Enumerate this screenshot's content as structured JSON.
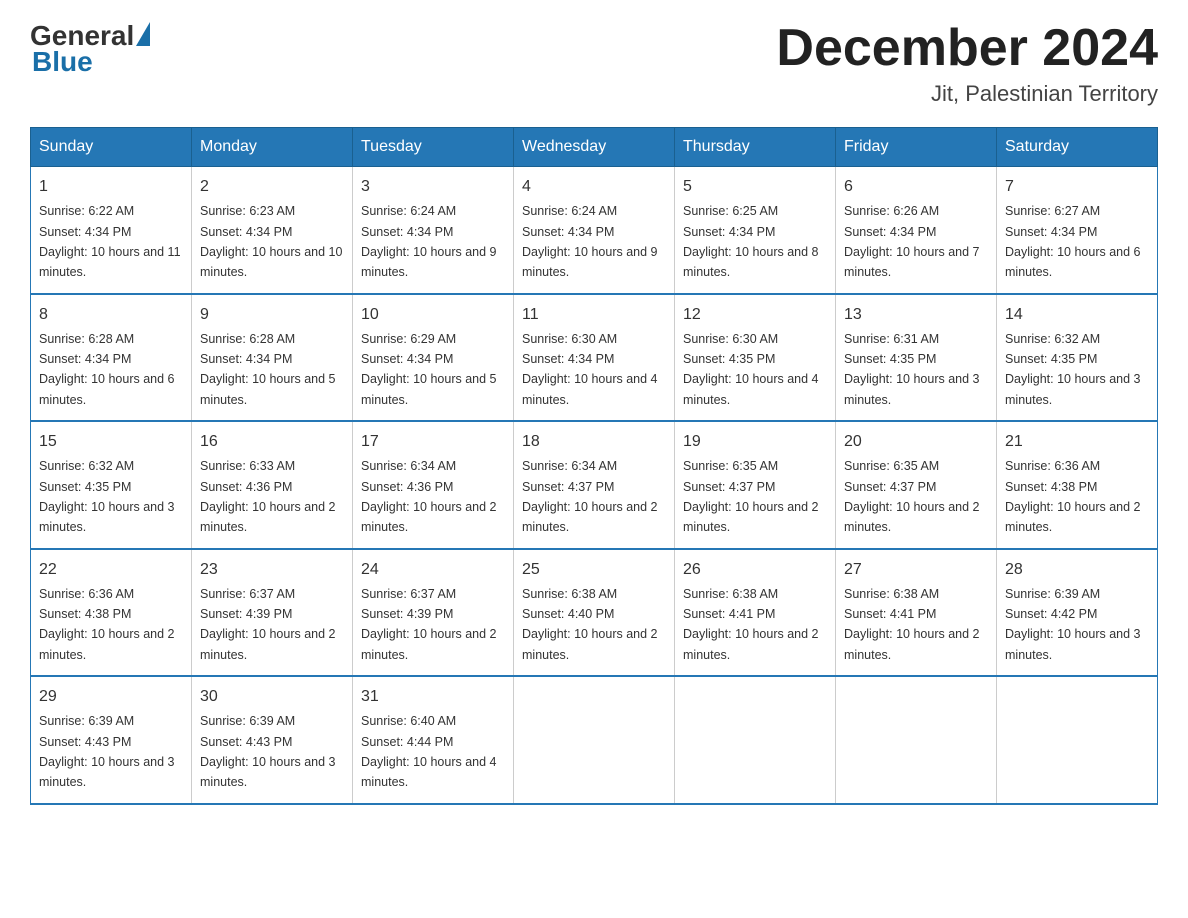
{
  "header": {
    "logo_general": "General",
    "logo_blue": "Blue",
    "month_year": "December 2024",
    "location": "Jit, Palestinian Territory"
  },
  "days_of_week": [
    "Sunday",
    "Monday",
    "Tuesday",
    "Wednesday",
    "Thursday",
    "Friday",
    "Saturday"
  ],
  "weeks": [
    [
      {
        "day": 1,
        "sunrise": "6:22 AM",
        "sunset": "4:34 PM",
        "daylight": "10 hours and 11 minutes."
      },
      {
        "day": 2,
        "sunrise": "6:23 AM",
        "sunset": "4:34 PM",
        "daylight": "10 hours and 10 minutes."
      },
      {
        "day": 3,
        "sunrise": "6:24 AM",
        "sunset": "4:34 PM",
        "daylight": "10 hours and 9 minutes."
      },
      {
        "day": 4,
        "sunrise": "6:24 AM",
        "sunset": "4:34 PM",
        "daylight": "10 hours and 9 minutes."
      },
      {
        "day": 5,
        "sunrise": "6:25 AM",
        "sunset": "4:34 PM",
        "daylight": "10 hours and 8 minutes."
      },
      {
        "day": 6,
        "sunrise": "6:26 AM",
        "sunset": "4:34 PM",
        "daylight": "10 hours and 7 minutes."
      },
      {
        "day": 7,
        "sunrise": "6:27 AM",
        "sunset": "4:34 PM",
        "daylight": "10 hours and 6 minutes."
      }
    ],
    [
      {
        "day": 8,
        "sunrise": "6:28 AM",
        "sunset": "4:34 PM",
        "daylight": "10 hours and 6 minutes."
      },
      {
        "day": 9,
        "sunrise": "6:28 AM",
        "sunset": "4:34 PM",
        "daylight": "10 hours and 5 minutes."
      },
      {
        "day": 10,
        "sunrise": "6:29 AM",
        "sunset": "4:34 PM",
        "daylight": "10 hours and 5 minutes."
      },
      {
        "day": 11,
        "sunrise": "6:30 AM",
        "sunset": "4:34 PM",
        "daylight": "10 hours and 4 minutes."
      },
      {
        "day": 12,
        "sunrise": "6:30 AM",
        "sunset": "4:35 PM",
        "daylight": "10 hours and 4 minutes."
      },
      {
        "day": 13,
        "sunrise": "6:31 AM",
        "sunset": "4:35 PM",
        "daylight": "10 hours and 3 minutes."
      },
      {
        "day": 14,
        "sunrise": "6:32 AM",
        "sunset": "4:35 PM",
        "daylight": "10 hours and 3 minutes."
      }
    ],
    [
      {
        "day": 15,
        "sunrise": "6:32 AM",
        "sunset": "4:35 PM",
        "daylight": "10 hours and 3 minutes."
      },
      {
        "day": 16,
        "sunrise": "6:33 AM",
        "sunset": "4:36 PM",
        "daylight": "10 hours and 2 minutes."
      },
      {
        "day": 17,
        "sunrise": "6:34 AM",
        "sunset": "4:36 PM",
        "daylight": "10 hours and 2 minutes."
      },
      {
        "day": 18,
        "sunrise": "6:34 AM",
        "sunset": "4:37 PM",
        "daylight": "10 hours and 2 minutes."
      },
      {
        "day": 19,
        "sunrise": "6:35 AM",
        "sunset": "4:37 PM",
        "daylight": "10 hours and 2 minutes."
      },
      {
        "day": 20,
        "sunrise": "6:35 AM",
        "sunset": "4:37 PM",
        "daylight": "10 hours and 2 minutes."
      },
      {
        "day": 21,
        "sunrise": "6:36 AM",
        "sunset": "4:38 PM",
        "daylight": "10 hours and 2 minutes."
      }
    ],
    [
      {
        "day": 22,
        "sunrise": "6:36 AM",
        "sunset": "4:38 PM",
        "daylight": "10 hours and 2 minutes."
      },
      {
        "day": 23,
        "sunrise": "6:37 AM",
        "sunset": "4:39 PM",
        "daylight": "10 hours and 2 minutes."
      },
      {
        "day": 24,
        "sunrise": "6:37 AM",
        "sunset": "4:39 PM",
        "daylight": "10 hours and 2 minutes."
      },
      {
        "day": 25,
        "sunrise": "6:38 AM",
        "sunset": "4:40 PM",
        "daylight": "10 hours and 2 minutes."
      },
      {
        "day": 26,
        "sunrise": "6:38 AM",
        "sunset": "4:41 PM",
        "daylight": "10 hours and 2 minutes."
      },
      {
        "day": 27,
        "sunrise": "6:38 AM",
        "sunset": "4:41 PM",
        "daylight": "10 hours and 2 minutes."
      },
      {
        "day": 28,
        "sunrise": "6:39 AM",
        "sunset": "4:42 PM",
        "daylight": "10 hours and 3 minutes."
      }
    ],
    [
      {
        "day": 29,
        "sunrise": "6:39 AM",
        "sunset": "4:43 PM",
        "daylight": "10 hours and 3 minutes."
      },
      {
        "day": 30,
        "sunrise": "6:39 AM",
        "sunset": "4:43 PM",
        "daylight": "10 hours and 3 minutes."
      },
      {
        "day": 31,
        "sunrise": "6:40 AM",
        "sunset": "4:44 PM",
        "daylight": "10 hours and 4 minutes."
      },
      null,
      null,
      null,
      null
    ]
  ]
}
